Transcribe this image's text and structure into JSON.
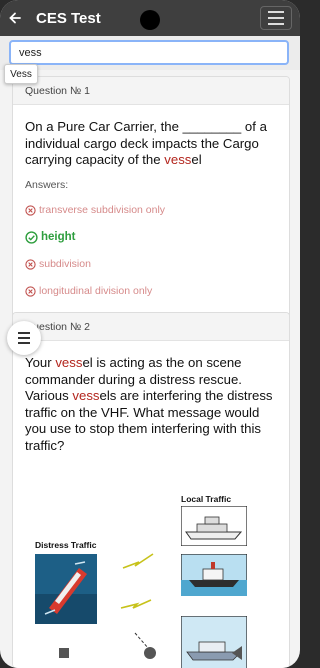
{
  "appbar": {
    "title": "CES Test",
    "back_icon": "arrow-left-icon",
    "menu_icon": "hamburger-icon"
  },
  "search": {
    "value": "vess",
    "suggestion": "Vess"
  },
  "questions": [
    {
      "header": "Question № 1",
      "text_parts": [
        "On a Pure Car Carrier, the ________ of a individual cargo deck impacts the Cargo carrying capacity of the ",
        "vess",
        "el"
      ],
      "answers_label": "Answers:",
      "answers": [
        {
          "text": "transverse subdivision only",
          "correct": false
        },
        {
          "text": "height",
          "correct": true
        },
        {
          "text": "subdivision",
          "correct": false
        },
        {
          "text": "longitudinal division only",
          "correct": false
        }
      ]
    },
    {
      "header": "Question № 2",
      "text_parts": [
        "Your ",
        "vess",
        "el is acting as the on scene commander during a distress rescue. Various ",
        "vess",
        "els are interfering the distress traffic on the VHF. What message would you use to stop them interfering with this traffic?"
      ],
      "figure": {
        "left_label": "Distress Traffic",
        "right_label": "Local Traffic"
      }
    }
  ],
  "colors": {
    "appbar": "#3f3f3f",
    "highlight": "#b3261e",
    "correct": "#2e9e3e",
    "incorrect": "#d68a8a",
    "search_border": "#8ab4f8"
  }
}
